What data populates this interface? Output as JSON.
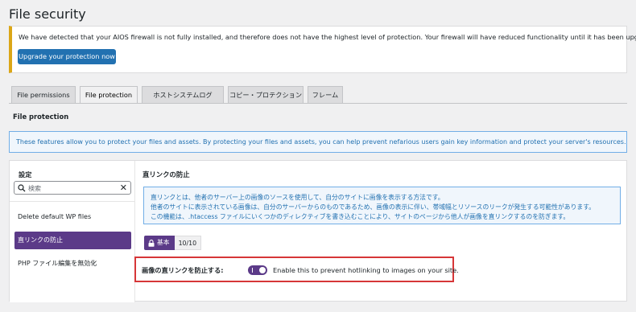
{
  "page": {
    "title": "File security"
  },
  "notice": {
    "text": "We have detected that your AIOS firewall is not fully installed, and therefore does not have the highest level of protection. Your firewall will have reduced functionality until it has been upgraded.",
    "button_label": "Upgrade your protection now",
    "accent_color": "#dba617"
  },
  "tabs": [
    {
      "label": "File permissions",
      "active": false
    },
    {
      "label": "File protection",
      "active": true
    },
    {
      "label": "ホストシステムログ",
      "active": false
    },
    {
      "label": "コピー・プロテクション",
      "active": false
    },
    {
      "label": "フレーム",
      "active": false
    }
  ],
  "section": {
    "heading": "File protection"
  },
  "info": {
    "text": "These features allow you to protect your files and assets. By protecting your files and assets, you can help prevent nefarious users gain key information and protect your server's resources."
  },
  "sidebar": {
    "title": "設定",
    "search_placeholder": "検索",
    "clear_icon": "close-icon",
    "items": [
      {
        "label": "Delete default WP files",
        "active": false
      },
      {
        "label": "直リンクの防止",
        "active": true
      },
      {
        "label": "PHP ファイル編集を無効化",
        "active": false
      }
    ]
  },
  "content": {
    "title": "直リンクの防止",
    "description": [
      "直リンクとは、他者のサーバー上の画像のソースを使用して、自分のサイトに画像を表示する方法です。",
      "他者のサイトに表示されている画像は、自分のサーバーからのものであるため、画像の表示に伴い、帯域幅とリソースのリークが発生する可能性があります。",
      "この機能は、.htaccess ファイルにいくつかのディレクティブを書き込むことにより、サイトのページから他人が画像を直リンクするのを防ぎます。"
    ],
    "badge": {
      "icon": "lock-icon",
      "level": "基本",
      "score": "10/10"
    },
    "setting": {
      "label": "画像の直リンクを防止する:",
      "enabled": true,
      "description": "Enable this to prevent hotlinking to images on your site."
    }
  },
  "colors": {
    "brand_purple": "#5b3a88",
    "primary_blue": "#2271b1",
    "highlight_red": "#d63638"
  }
}
